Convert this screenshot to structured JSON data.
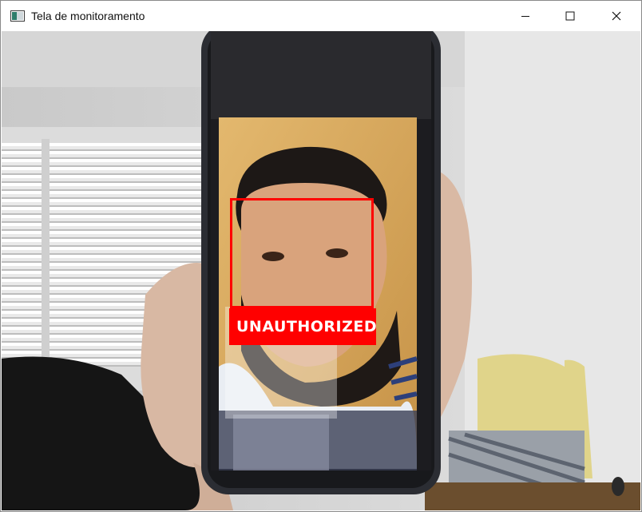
{
  "window": {
    "title": "Tela de monitoramento",
    "controls": [
      "minimize",
      "maximize",
      "close"
    ]
  },
  "video": {
    "detection": {
      "label": "UNAUTHORIZED",
      "color": "#ff0000"
    }
  },
  "colors": {
    "titlebar": "#ffffff",
    "detection": "#ff0000"
  }
}
